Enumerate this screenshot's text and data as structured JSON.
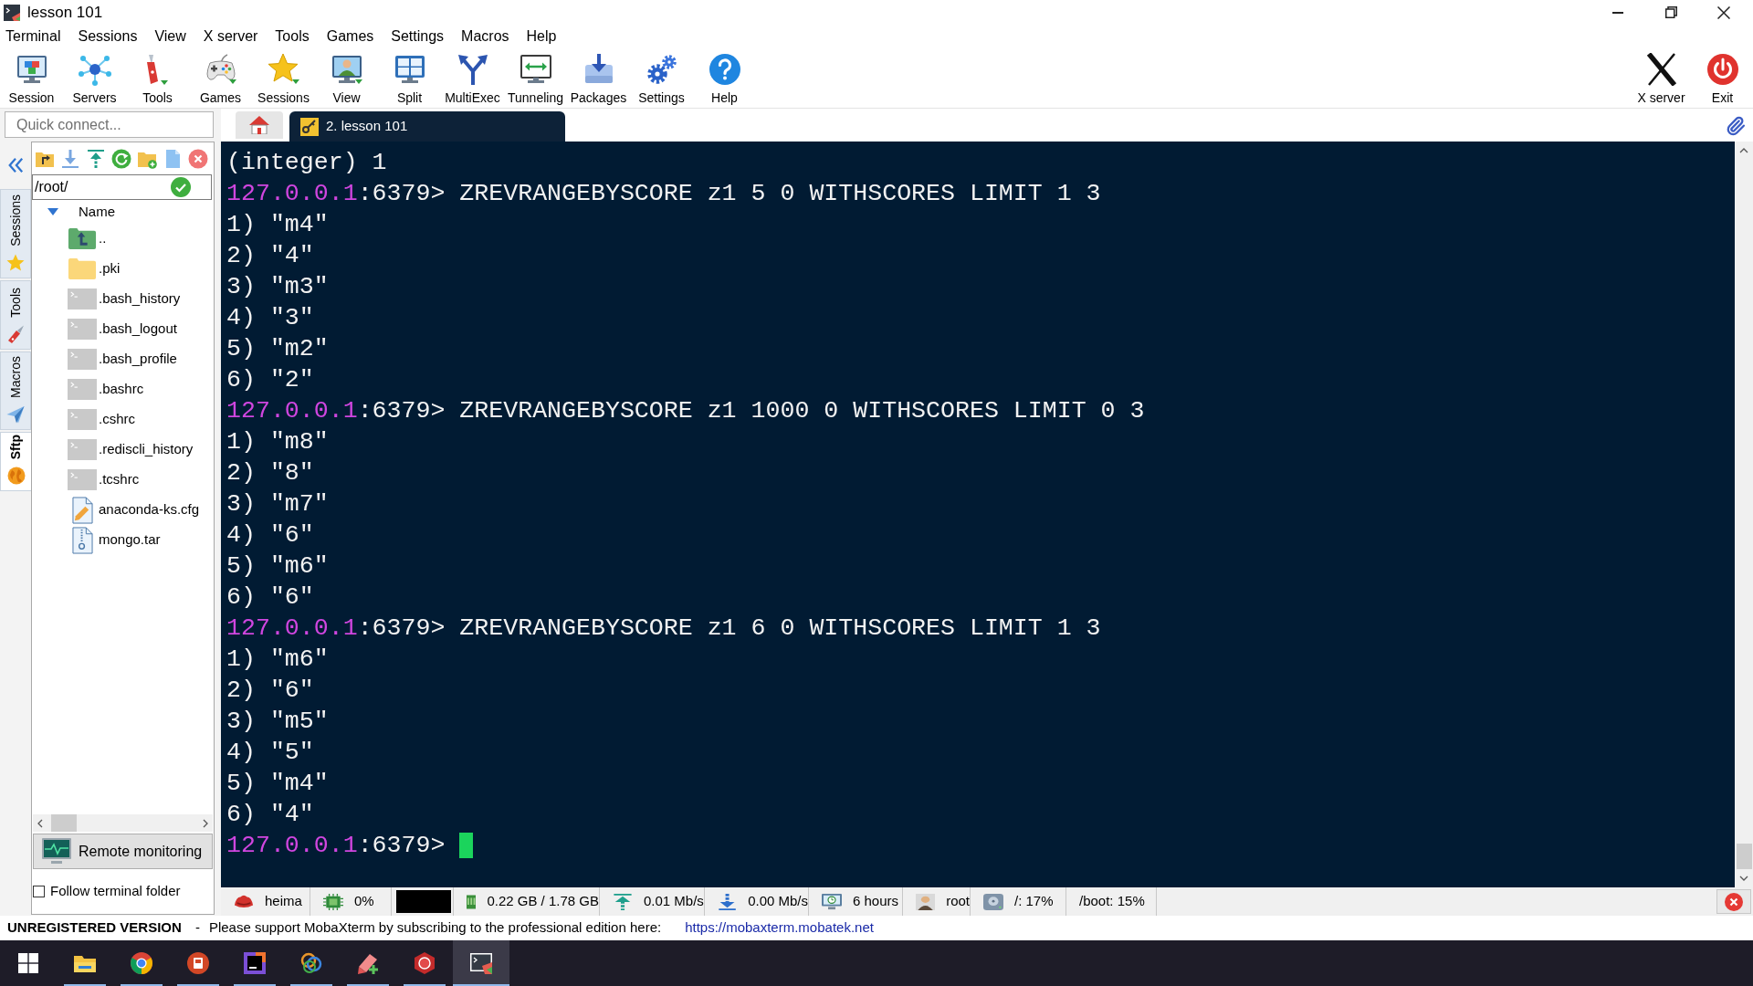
{
  "window": {
    "title": "lesson 101"
  },
  "menu": [
    "Terminal",
    "Sessions",
    "View",
    "X server",
    "Tools",
    "Games",
    "Settings",
    "Macros",
    "Help"
  ],
  "toolbar": {
    "left": [
      "Session",
      "Servers",
      "Tools",
      "Games",
      "Sessions",
      "View",
      "Split",
      "MultiExec",
      "Tunneling",
      "Packages",
      "Settings",
      "Help"
    ],
    "right": [
      "X server",
      "Exit"
    ]
  },
  "quick_connect": {
    "placeholder": "Quick connect..."
  },
  "tabs": [
    {
      "kind": "home",
      "selected": false
    },
    {
      "kind": "session",
      "label": "2. lesson 101",
      "selected": true
    }
  ],
  "side_tabs": [
    {
      "label": "Sessions",
      "selected": false
    },
    {
      "label": "Tools",
      "selected": false
    },
    {
      "label": "Macros",
      "selected": false
    },
    {
      "label": "Sftp",
      "selected": true
    }
  ],
  "sftp": {
    "path": "/root/",
    "column": "Name",
    "files": [
      {
        "name": "..",
        "kind": "parent"
      },
      {
        "name": ".pki",
        "kind": "folder"
      },
      {
        "name": ".bash_history",
        "kind": "script"
      },
      {
        "name": ".bash_logout",
        "kind": "script"
      },
      {
        "name": ".bash_profile",
        "kind": "script"
      },
      {
        "name": ".bashrc",
        "kind": "script"
      },
      {
        "name": ".cshrc",
        "kind": "script"
      },
      {
        "name": ".rediscli_history",
        "kind": "script"
      },
      {
        "name": ".tcshrc",
        "kind": "script"
      },
      {
        "name": "anaconda-ks.cfg",
        "kind": "config"
      },
      {
        "name": "mongo.tar",
        "kind": "archive"
      }
    ],
    "monitoring_button": "Remote monitoring",
    "follow_folder": {
      "label": "Follow terminal folder",
      "checked": false
    }
  },
  "terminal": {
    "cursor": true,
    "lines": [
      {
        "kind": "output",
        "text": "(integer) 1"
      },
      {
        "kind": "prompt",
        "host": "127.0.0.1",
        "port": ":6379>",
        "command": "ZREVRANGEBYSCORE z1 5 0 WITHSCORES LIMIT 1 3"
      },
      {
        "kind": "output",
        "text": "1) \"m4\""
      },
      {
        "kind": "output",
        "text": "2) \"4\""
      },
      {
        "kind": "output",
        "text": "3) \"m3\""
      },
      {
        "kind": "output",
        "text": "4) \"3\""
      },
      {
        "kind": "output",
        "text": "5) \"m2\""
      },
      {
        "kind": "output",
        "text": "6) \"2\""
      },
      {
        "kind": "prompt",
        "host": "127.0.0.1",
        "port": ":6379>",
        "command": "ZREVRANGEBYSCORE z1 1000 0 WITHSCORES LIMIT 0 3"
      },
      {
        "kind": "output",
        "text": "1) \"m8\""
      },
      {
        "kind": "output",
        "text": "2) \"8\""
      },
      {
        "kind": "output",
        "text": "3) \"m7\""
      },
      {
        "kind": "output",
        "text": "4) \"6\""
      },
      {
        "kind": "output",
        "text": "5) \"m6\""
      },
      {
        "kind": "output",
        "text": "6) \"6\""
      },
      {
        "kind": "prompt",
        "host": "127.0.0.1",
        "port": ":6379>",
        "command": "ZREVRANGEBYSCORE z1 6 0 WITHSCORES LIMIT 1 3"
      },
      {
        "kind": "output",
        "text": "1) \"m6\""
      },
      {
        "kind": "output",
        "text": "2) \"6\""
      },
      {
        "kind": "output",
        "text": "3) \"m5\""
      },
      {
        "kind": "output",
        "text": "4) \"5\""
      },
      {
        "kind": "output",
        "text": "5) \"m4\""
      },
      {
        "kind": "output",
        "text": "6) \"4\""
      },
      {
        "kind": "prompt",
        "host": "127.0.0.1",
        "port": ":6379>"
      }
    ]
  },
  "status_bar": [
    {
      "kind": "user",
      "text": "heima"
    },
    {
      "kind": "cpu",
      "text": "0%"
    },
    {
      "kind": "graph"
    },
    {
      "kind": "memory",
      "text": "0.22 GB / 1.78 GB"
    },
    {
      "kind": "upload",
      "text": "0.01 Mb/s"
    },
    {
      "kind": "download",
      "text": "0.00 Mb/s"
    },
    {
      "kind": "uptime",
      "text": "6 hours"
    },
    {
      "kind": "login",
      "text": "root"
    },
    {
      "kind": "disk",
      "text": "/: 17%"
    },
    {
      "kind": "plain",
      "text": "/boot: 15%"
    }
  ],
  "notice": {
    "title": "UNREGISTERED VERSION",
    "dash": "-",
    "message": "Please support MobaXterm by subscribing to the professional edition here:",
    "link": "https://mobaxterm.mobatek.net"
  },
  "taskbar": {
    "apps": [
      {
        "selected": false
      },
      {
        "selected": false
      },
      {
        "selected": false
      },
      {
        "selected": false
      },
      {
        "selected": false
      },
      {
        "selected": false
      },
      {
        "selected": false
      },
      {
        "selected": true
      }
    ]
  }
}
